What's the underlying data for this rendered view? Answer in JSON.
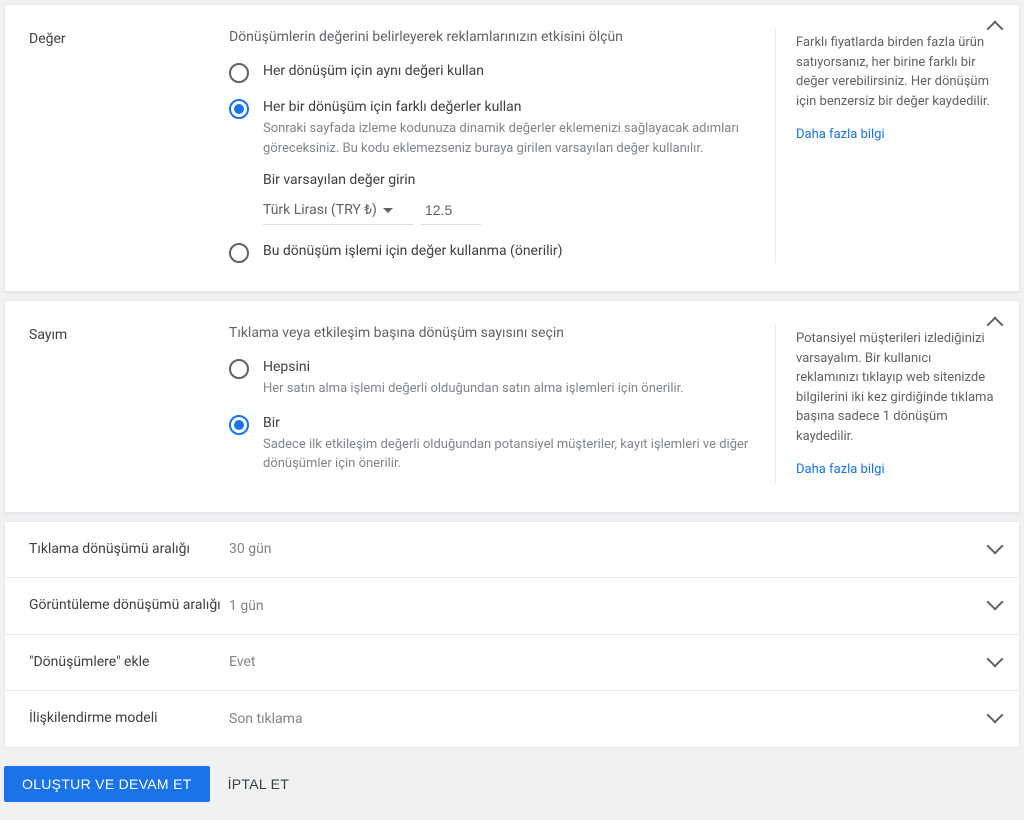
{
  "value_section": {
    "label": "Değer",
    "description": "Dönüşümlerin değerini belirleyerek reklamlarınızın etkisini ölçün",
    "options": {
      "same": "Her dönüşüm için aynı değeri kullan",
      "diff": "Her bir dönüşüm için farklı değerler kullan",
      "diff_sub": "Sonraki sayfada izleme kodunuza dinamik değerler eklemenizi sağlayacak adımları göreceksiniz. Bu kodu eklemezseniz buraya girilen varsayılan değer kullanılır.",
      "none": "Bu dönüşüm işlemi için değer kullanma (önerilir)"
    },
    "default_value_label": "Bir varsayılan değer girin",
    "currency": "Türk Lirası (TRY ₺)",
    "default_value": "12.5",
    "info": "Farklı fiyatlarda birden fazla ürün satıyorsanız, her birine farklı bir değer verebilirsiniz. Her dönüşüm için benzersiz bir değer kaydedilir.",
    "info_link": "Daha fazla bilgi"
  },
  "count_section": {
    "label": "Sayım",
    "description": "Tıklama veya etkileşim başına dönüşüm sayısını seçin",
    "options": {
      "all": "Hepsini",
      "all_sub": "Her satın alma işlemi değerli olduğundan satın alma işlemleri için önerilir.",
      "one": "Bir",
      "one_sub": "Sadece ilk etkileşim değerli olduğundan potansiyel müşteriler, kayıt işlemleri ve diğer dönüşümler için önerilir."
    },
    "info": "Potansiyel müşterileri izlediğinizi varsayalım. Bir kullanıcı reklamınızı tıklayıp web sitenizde bilgilerini iki kez girdiğinde tıklama başına sadece 1 dönüşüm kaydedilir.",
    "info_link": "Daha fazla bilgi"
  },
  "collapsed": {
    "click_window": {
      "label": "Tıklama dönüşümü aralığı",
      "value": "30 gün"
    },
    "view_window": {
      "label": "Görüntüleme dönüşümü aralığı",
      "value": "1 gün"
    },
    "include": {
      "label": "\"Dönüşümlere\" ekle",
      "value": "Evet"
    },
    "attribution": {
      "label": "İlişkilendirme modeli",
      "value": "Son tıklama"
    }
  },
  "footer": {
    "create": "OLUŞTUR VE DEVAM ET",
    "cancel": "İPTAL ET"
  }
}
